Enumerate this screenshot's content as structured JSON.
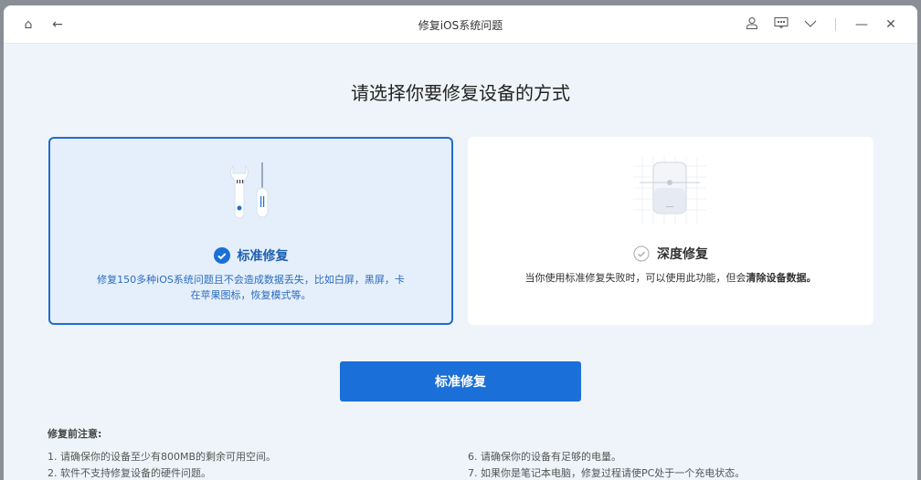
{
  "window": {
    "title": "修复iOS系统问题"
  },
  "heading": "请选择你要修复设备的方式",
  "options": [
    {
      "title": "标准修复",
      "description": "修复150多种iOS系统问题且不会造成数据丢失，比如白屏，黑屏，卡在苹果图标，恢复模式等。",
      "selected": true
    },
    {
      "title": "深度修复",
      "description_plain": "当你使用标准修复失败时，可以使用此功能，但会",
      "description_bold": "清除设备数据。",
      "selected": false
    }
  ],
  "action_button": "标准修复",
  "notes": {
    "title": "修复前注意:",
    "items_left": [
      "1.  请确保你的设备至少有800MB的剩余可用空间。",
      "2.  软件不支持修复设备的硬件问题。"
    ],
    "items_right": [
      "6.  请确保你的设备有足够的电量。",
      "7.  如果你是笔记本电脑，修复过程请使PC处于一个充电状态。"
    ]
  },
  "colors": {
    "accent": "#1a6fd8"
  }
}
